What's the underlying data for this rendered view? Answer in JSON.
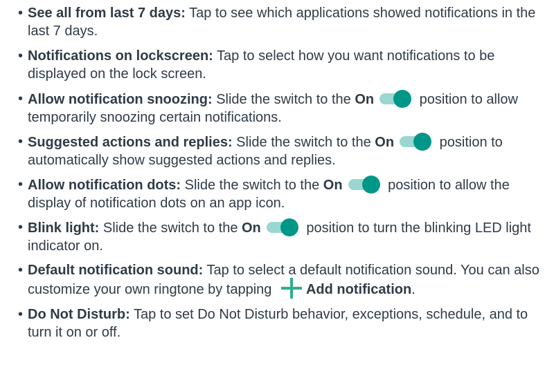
{
  "items": [
    {
      "label": "See all from last 7 days:",
      "desc": " Tap to see which applications showed notifications in the last 7 days."
    },
    {
      "label": "Notifications on lockscreen:",
      "desc": " Tap to select how you want notifications to be displayed on the lock screen."
    },
    {
      "label": "Allow notification snoozing:",
      "pre": " Slide the switch to the ",
      "on": "On",
      "post": " position to allow temporarily snoozing certain notifications."
    },
    {
      "label": "Suggested actions and replies:",
      "pre": " Slide the switch to the ",
      "on": "On",
      "post": " position to automatically show suggested actions and replies."
    },
    {
      "label": "Allow notification dots:",
      "pre": " Slide the switch to the ",
      "on": "On",
      "post": " position to allow the display of notification dots on an app icon."
    },
    {
      "label": "Blink light:",
      "pre": " Slide the switch to the ",
      "on": "On",
      "post": " position to turn the blinking LED light indicator on."
    },
    {
      "label": "Default notification sound:",
      "pre": " Tap to select a default notification sound. You can also customize your own ringtone by tapping ",
      "action": "Add notification",
      "post": "."
    },
    {
      "label": "Do Not Disturb:",
      "desc": " Tap to set Do Not Disturb behavior, exceptions, schedule, and to turn it on or off."
    }
  ],
  "colors": {
    "text": "#2f3b47",
    "toggle_thumb": "#009688",
    "toggle_track": "#9ad7d1",
    "plus_icon": "#2baf8f"
  },
  "icons": [
    "toggle-switch-icon",
    "plus-icon"
  ]
}
